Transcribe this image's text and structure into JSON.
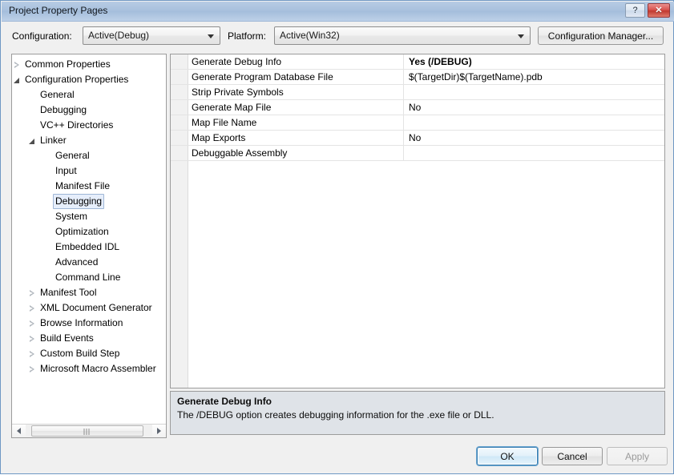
{
  "window": {
    "title": "Project Property Pages",
    "help_button": "?",
    "close_button": "✕"
  },
  "toolbar": {
    "configuration_label": "Configuration:",
    "configuration_value": "Active(Debug)",
    "platform_label": "Platform:",
    "platform_value": "Active(Win32)",
    "configuration_manager_label": "Configuration Manager..."
  },
  "tree": {
    "nodes": [
      {
        "label": "Common Properties",
        "indent": 0,
        "twisty": "collapsed",
        "selected": false
      },
      {
        "label": "Configuration Properties",
        "indent": 0,
        "twisty": "expanded",
        "selected": false
      },
      {
        "label": "General",
        "indent": 1,
        "twisty": "none",
        "selected": false
      },
      {
        "label": "Debugging",
        "indent": 1,
        "twisty": "none",
        "selected": false
      },
      {
        "label": "VC++ Directories",
        "indent": 1,
        "twisty": "none",
        "selected": false
      },
      {
        "label": "Linker",
        "indent": 1,
        "twisty": "expanded",
        "selected": false
      },
      {
        "label": "General",
        "indent": 2,
        "twisty": "none",
        "selected": false
      },
      {
        "label": "Input",
        "indent": 2,
        "twisty": "none",
        "selected": false
      },
      {
        "label": "Manifest File",
        "indent": 2,
        "twisty": "none",
        "selected": false
      },
      {
        "label": "Debugging",
        "indent": 2,
        "twisty": "none",
        "selected": true
      },
      {
        "label": "System",
        "indent": 2,
        "twisty": "none",
        "selected": false
      },
      {
        "label": "Optimization",
        "indent": 2,
        "twisty": "none",
        "selected": false
      },
      {
        "label": "Embedded IDL",
        "indent": 2,
        "twisty": "none",
        "selected": false
      },
      {
        "label": "Advanced",
        "indent": 2,
        "twisty": "none",
        "selected": false
      },
      {
        "label": "Command Line",
        "indent": 2,
        "twisty": "none",
        "selected": false
      },
      {
        "label": "Manifest Tool",
        "indent": 1,
        "twisty": "collapsed",
        "selected": false
      },
      {
        "label": "XML Document Generator",
        "indent": 1,
        "twisty": "collapsed",
        "selected": false
      },
      {
        "label": "Browse Information",
        "indent": 1,
        "twisty": "collapsed",
        "selected": false
      },
      {
        "label": "Build Events",
        "indent": 1,
        "twisty": "collapsed",
        "selected": false
      },
      {
        "label": "Custom Build Step",
        "indent": 1,
        "twisty": "collapsed",
        "selected": false
      },
      {
        "label": "Microsoft Macro Assembler",
        "indent": 1,
        "twisty": "collapsed",
        "selected": false
      }
    ],
    "scrollbar": {
      "left_arrow": "◄",
      "right_arrow": "►"
    }
  },
  "grid": {
    "rows": [
      {
        "name": "Generate Debug Info",
        "value": "Yes (/DEBUG)",
        "bold": true
      },
      {
        "name": "Generate Program Database File",
        "value": "$(TargetDir)$(TargetName).pdb",
        "bold": false
      },
      {
        "name": "Strip Private Symbols",
        "value": "",
        "bold": false
      },
      {
        "name": "Generate Map File",
        "value": "No",
        "bold": false
      },
      {
        "name": "Map File Name",
        "value": "",
        "bold": false
      },
      {
        "name": "Map Exports",
        "value": "No",
        "bold": false
      },
      {
        "name": "Debuggable Assembly",
        "value": "",
        "bold": false
      }
    ]
  },
  "description": {
    "title": "Generate Debug Info",
    "body": "The /DEBUG option creates debugging information for the .exe file or DLL."
  },
  "footer": {
    "ok_label": "OK",
    "cancel_label": "Cancel",
    "apply_label": "Apply"
  },
  "colors": {
    "titlebar_top": "#b7cce4",
    "titlebar_bottom": "#bdd1e8",
    "dialog_background": "#f0f0f0",
    "description_background": "#dfe3e8",
    "selection_blue": "#e6eefb",
    "focus_border": "#3c7fb1",
    "close_button_red": "#d9534f"
  }
}
